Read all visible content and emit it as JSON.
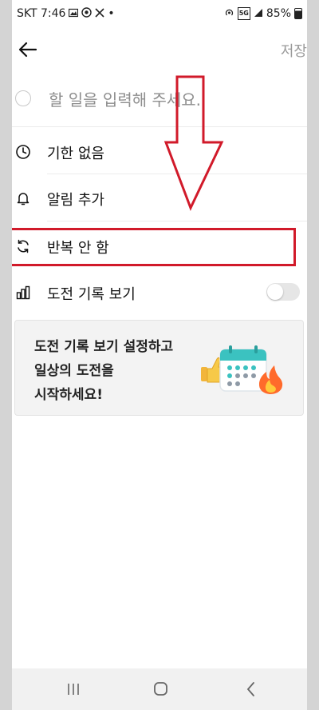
{
  "status_bar": {
    "carrier_time": "SKT 7:46",
    "left_icons": [
      "gallery-icon",
      "lens-icon",
      "x-icon"
    ],
    "dot": "•",
    "network": "5G",
    "battery": "85%"
  },
  "header": {
    "save_label": "저장"
  },
  "todo": {
    "placeholder": "할 일을 입력해 주세요."
  },
  "options": {
    "deadline": "기한 없음",
    "alarm": "알림 추가",
    "repeat": "반복 안 함",
    "challenge": "도전 기록 보기",
    "challenge_toggle_on": false
  },
  "banner": {
    "line1": "도전 기록 보기 설정하고",
    "line2": "일상의 도전을",
    "line3": "시작하세요!"
  },
  "colors": {
    "annotation_red": "#d11a2a",
    "save_gray": "#9a9a9a"
  }
}
